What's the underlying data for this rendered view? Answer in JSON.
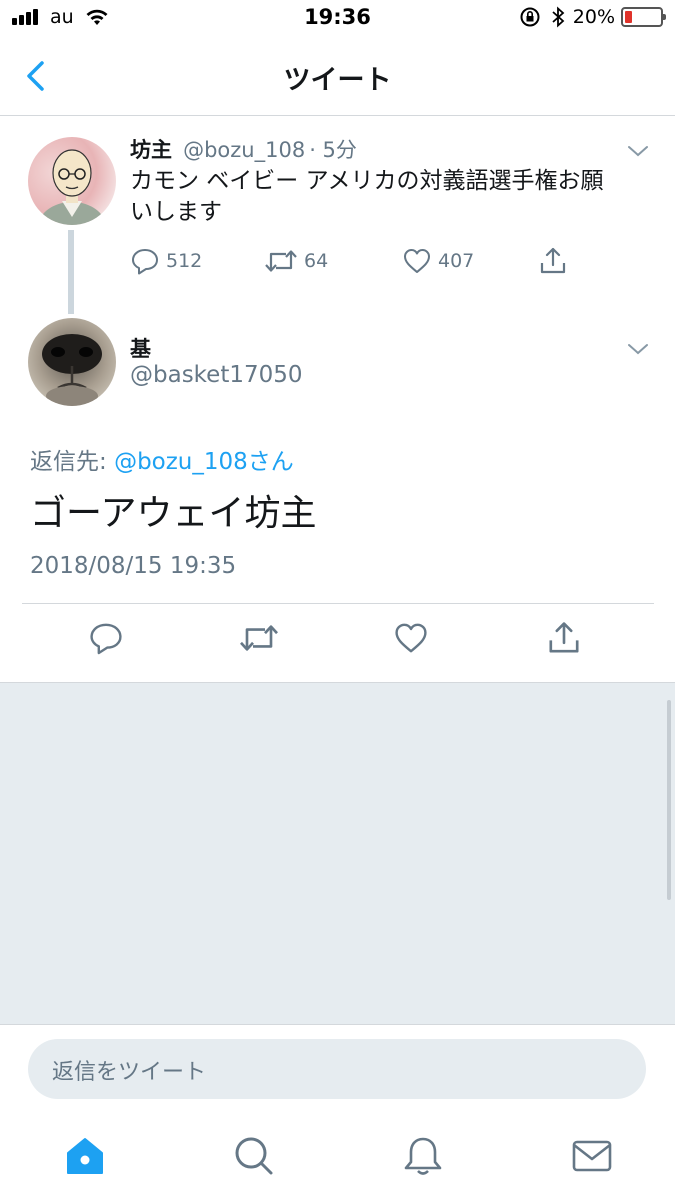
{
  "status_bar": {
    "carrier": "au",
    "time": "19:36",
    "battery_percent": "20%",
    "battery_level": 0.2
  },
  "nav": {
    "title": "ツイート"
  },
  "parent_tweet": {
    "name": "坊主",
    "handle": "@bozu_108",
    "time_ago": "· 5分",
    "text_line1": "カモン ベイビー アメリカの対義語選手権お願",
    "text_line2": "いします",
    "replies": "512",
    "retweets": "64",
    "likes": "407"
  },
  "main_tweet": {
    "name": "基",
    "handle": "@basket17050",
    "reply_label": "返信先: ",
    "reply_mention": "@bozu_108さん",
    "text": "ゴーアウェイ坊主",
    "timestamp": "2018/08/15 19:35"
  },
  "compose": {
    "placeholder": "返信をツイート"
  },
  "tabs": [
    "home-icon",
    "search-icon",
    "notifications-icon",
    "messages-icon"
  ],
  "colors": {
    "accent": "#1da1f2",
    "muted": "#657786",
    "background_gray": "#e6ecf0"
  }
}
